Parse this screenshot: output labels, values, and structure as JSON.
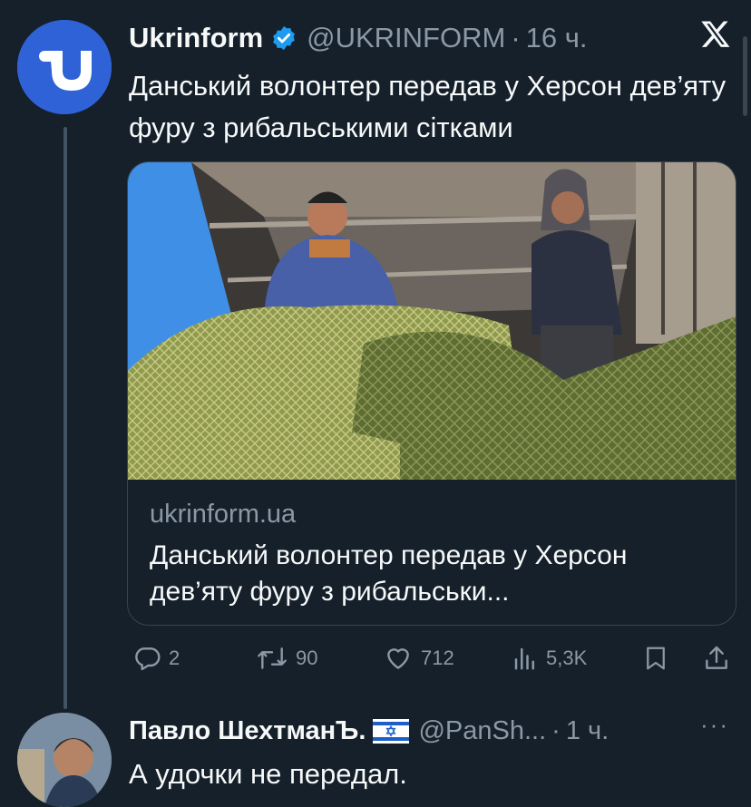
{
  "tweet": {
    "author_name": "Ukrinform",
    "handle": "@UKRINFORM",
    "separator": "·",
    "time": "16 ч.",
    "text": "Данський волонтер передав у Херсон дев’яту фуру з рибальськими сітками",
    "card": {
      "domain": "ukrinform.ua",
      "title": "Данський волонтер передав у Херсон дев’яту фуру з рибальськи..."
    },
    "actions": {
      "replies": "2",
      "retweets": "90",
      "likes": "712",
      "views": "5,3K"
    }
  },
  "reply": {
    "author_name": "Павло ШехтманЪ.",
    "handle": "@PanSh...",
    "separator": "·",
    "time": "1 ч.",
    "more_label": "···",
    "text": "А удочки не передал."
  },
  "colors": {
    "background": "#15202b",
    "accent": "#1d9bf0",
    "muted": "#8b98a5",
    "ukrinform_blue": "#2f62d6"
  },
  "icons": [
    "ukrinform-logo-icon",
    "verified-badge-icon",
    "x-logo-icon",
    "reply-icon",
    "retweet-icon",
    "like-icon",
    "views-icon",
    "bookmark-icon",
    "share-icon",
    "israel-flag-icon"
  ]
}
